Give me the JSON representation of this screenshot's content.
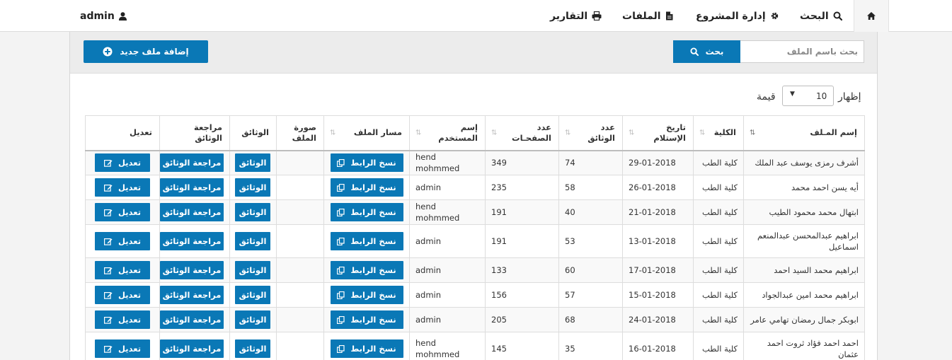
{
  "nav": {
    "home_icon": "home-icon",
    "search": {
      "label": "البحث",
      "icon": "search-icon"
    },
    "project": {
      "label": "إدارة المشروع",
      "icon": "gear-icon"
    },
    "files": {
      "label": "الملفات",
      "icon": "file-icon"
    },
    "reports": {
      "label": "التقارير",
      "icon": "print-icon"
    },
    "user": {
      "label": "admin",
      "icon": "user-icon"
    }
  },
  "toolbar": {
    "add_label": "إضافة ملف جديد",
    "add_icon": "plus-circle-icon",
    "search_placeholder": "بحث باسم الملف",
    "search_value": "",
    "search_button": "بحث"
  },
  "pager": {
    "show_label": "إظهار",
    "page_size": "10",
    "unit_label": "قيمة"
  },
  "colors": {
    "primary": "#0a78b6",
    "header_bg": "#ececec"
  },
  "table": {
    "headers": [
      {
        "l1": "إسم المـلف",
        "l2": ""
      },
      {
        "l1": "الكلية",
        "l2": ""
      },
      {
        "l1": "تاريخ",
        "l2": "الإستلام"
      },
      {
        "l1": "عدد",
        "l2": "الوثائق"
      },
      {
        "l1": "عدد",
        "l2": "الصفحـات"
      },
      {
        "l1": "إسم",
        "l2": "المستخدم"
      },
      {
        "l1": "مسار الملف",
        "l2": ""
      },
      {
        "l1": "صورة",
        "l2": "الملف"
      },
      {
        "l1": "الوثائق",
        "l2": ""
      },
      {
        "l1": "مراجعة الوثائق",
        "l2": ""
      },
      {
        "l1": "تعديل",
        "l2": ""
      }
    ],
    "btn_copy": "نسخ الرابط",
    "btn_docs": "الوثائق",
    "btn_review": "مراجعة الوثائق",
    "btn_edit": "تعديل",
    "rows": [
      {
        "name": "أشرف رمزى يوسف عبد الملك",
        "college": "كلية الطب",
        "date": "29-01-2018",
        "docs": "74",
        "pages": "349",
        "user": "hend mohmmed"
      },
      {
        "name": "أيه يسن احمد محمد",
        "college": "كلية الطب",
        "date": "26-01-2018",
        "docs": "58",
        "pages": "235",
        "user": "admin"
      },
      {
        "name": "ابتهال محمد محمود الطيب",
        "college": "كلية الطب",
        "date": "21-01-2018",
        "docs": "40",
        "pages": "191",
        "user": "hend mohmmed"
      },
      {
        "name": "ابراهيم عبدالمحسن عبدالمنعم اسماعيل",
        "college": "كلية الطب",
        "date": "13-01-2018",
        "docs": "53",
        "pages": "191",
        "user": "admin"
      },
      {
        "name": "ابراهيم محمد السيد احمد",
        "college": "كلية الطب",
        "date": "17-01-2018",
        "docs": "60",
        "pages": "133",
        "user": "admin"
      },
      {
        "name": "ابراهيم محمد امين عبدالجواد",
        "college": "كلية الطب",
        "date": "15-01-2018",
        "docs": "57",
        "pages": "156",
        "user": "admin"
      },
      {
        "name": "ابوبكر جمال رمضان تهامي عامر",
        "college": "كلية الطب",
        "date": "24-01-2018",
        "docs": "68",
        "pages": "205",
        "user": "admin"
      },
      {
        "name": "احمد احمد فؤاد ثروت احمد عثمان",
        "college": "كلية الطب",
        "date": "16-01-2018",
        "docs": "35",
        "pages": "145",
        "user": "hend mohmmed"
      }
    ]
  }
}
